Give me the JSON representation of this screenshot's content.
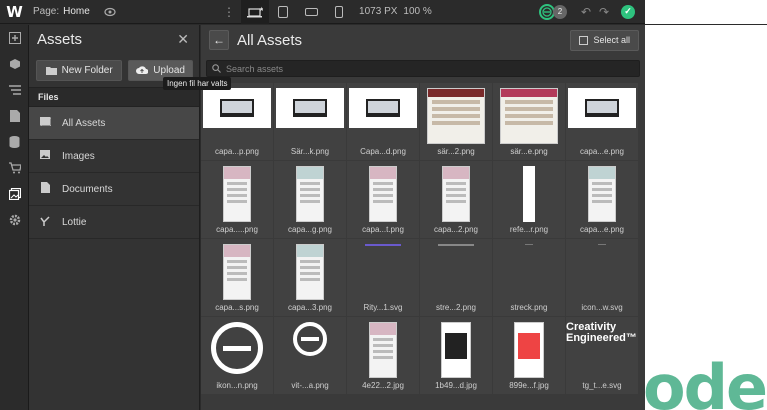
{
  "topbar": {
    "logo": "W",
    "page_label": "Page:",
    "page_value": "Home",
    "width_value": "1073",
    "width_unit": "PX",
    "zoom": "100 %",
    "collaborators_count": "2"
  },
  "assets_panel": {
    "title": "Assets",
    "new_folder_label": "New Folder",
    "upload_label": "Upload",
    "upload_tooltip": "Ingen fil har valts",
    "files_label": "Files",
    "items": [
      {
        "label": "All Assets",
        "icon": "all-assets-icon"
      },
      {
        "label": "Images",
        "icon": "image-icon"
      },
      {
        "label": "Documents",
        "icon": "document-icon"
      },
      {
        "label": "Lottie",
        "icon": "lottie-icon"
      }
    ]
  },
  "grid_panel": {
    "title": "All Assets",
    "select_all_label": "Select all",
    "search_placeholder": "Search assets",
    "assets": [
      {
        "name": "capa...p.png",
        "kind": "wide"
      },
      {
        "name": "Sär...k.png",
        "kind": "wide"
      },
      {
        "name": "Capa...d.png",
        "kind": "wide"
      },
      {
        "name": "sär...2.png",
        "kind": "page"
      },
      {
        "name": "sär...e.png",
        "kind": "page-pink"
      },
      {
        "name": "capa...e.png",
        "kind": "wide"
      },
      {
        "name": "capa.....png",
        "kind": "tall"
      },
      {
        "name": "capa...g.png",
        "kind": "tall-teal"
      },
      {
        "name": "capa...t.png",
        "kind": "tall"
      },
      {
        "name": "capa...2.png",
        "kind": "tall"
      },
      {
        "name": "refe...r.png",
        "kind": "line"
      },
      {
        "name": "capa...e.png",
        "kind": "tall-teal"
      },
      {
        "name": "capa...s.png",
        "kind": "tall"
      },
      {
        "name": "capa...3.png",
        "kind": "tall-teal"
      },
      {
        "name": "Rity...1.svg",
        "kind": "svgline"
      },
      {
        "name": "stre...2.png",
        "kind": "svgline-grey"
      },
      {
        "name": "streck.png",
        "kind": "dot"
      },
      {
        "name": "icon...w.svg",
        "kind": "dot"
      },
      {
        "name": "ikon...n.png",
        "kind": "logo"
      },
      {
        "name": "vit-...a.png",
        "kind": "logo-small"
      },
      {
        "name": "4e22...2.jpg",
        "kind": "tall"
      },
      {
        "name": "1b49...d.jpg",
        "kind": "phone"
      },
      {
        "name": "899e...f.jpg",
        "kind": "phone-color"
      },
      {
        "name": "tg_t...e.svg",
        "kind": "text",
        "text": "Creativity Engineered™"
      }
    ]
  },
  "canvas": {
    "visible_text": "ode"
  }
}
